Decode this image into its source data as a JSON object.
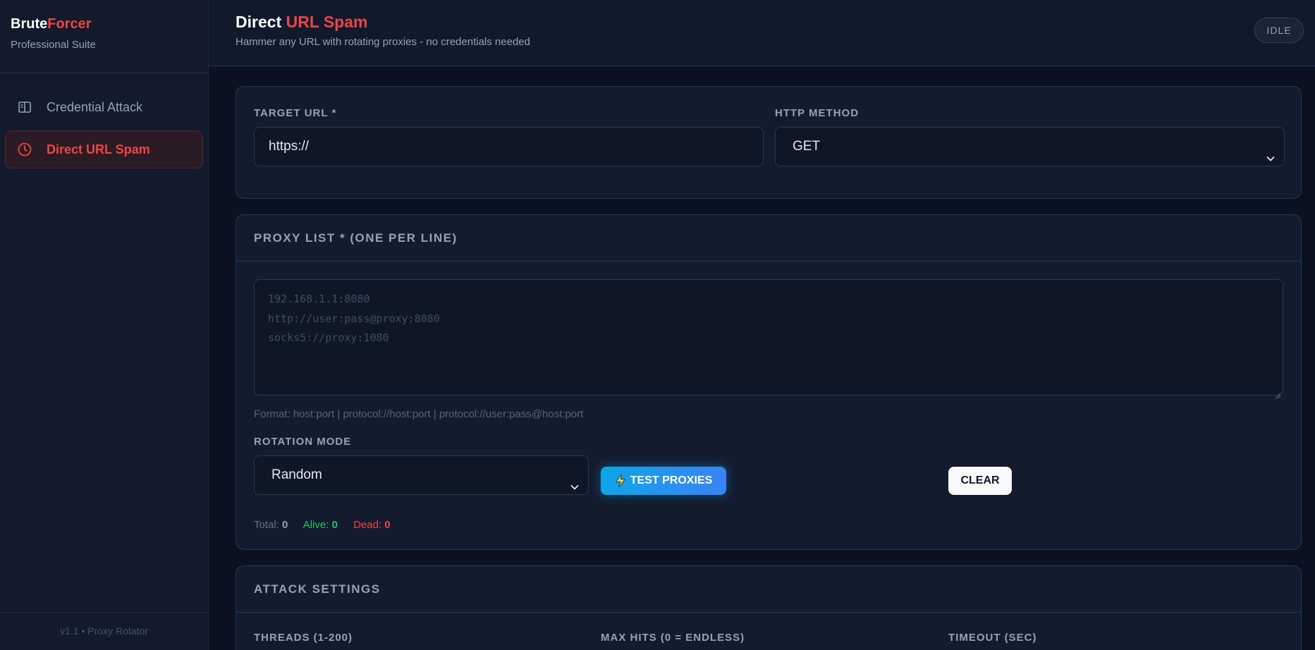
{
  "brand": {
    "name_a": "Brute",
    "name_b": "Forcer",
    "subtitle": "Professional Suite"
  },
  "nav": {
    "items": [
      {
        "label": "Credential Attack",
        "icon": "sidebar-panel-icon",
        "active": false
      },
      {
        "label": "Direct URL Spam",
        "icon": "clock-icon",
        "active": true
      }
    ]
  },
  "footer": {
    "version": "v1.1 • Proxy Rotator"
  },
  "header": {
    "title_a": "Direct",
    "title_b": "URL Spam",
    "subtitle": "Hammer any URL with rotating proxies - no credentials needed",
    "status": "IDLE"
  },
  "target": {
    "url_label": "TARGET URL *",
    "url_value": "https://",
    "method_label": "HTTP METHOD",
    "method_value": "GET"
  },
  "proxy": {
    "section_title": "PROXY LIST * (ONE PER LINE)",
    "placeholder_lines": [
      "192.168.1.1:8080",
      "http://user:pass@proxy:8080",
      "socks5://proxy:1080"
    ],
    "format_hint": "Format: host:port | protocol://host:port | protocol://user:pass@host:port",
    "rotation_label": "ROTATION MODE",
    "rotation_value": "Random",
    "test_button": "TEST PROXIES",
    "clear_button": "CLEAR",
    "stats": {
      "total_label": "Total:",
      "total": "0",
      "alive_label": "Alive:",
      "alive": "0",
      "dead_label": "Dead:",
      "dead": "0"
    }
  },
  "attack": {
    "section_title": "ATTACK SETTINGS",
    "threads_label": "THREADS (1-200)",
    "max_hits_label": "MAX HITS (0 = ENDLESS)",
    "timeout_label": "TIMEOUT (SEC)"
  },
  "colors": {
    "accent": "#ef4444",
    "background": "#0b1120",
    "card": "#131c2e",
    "success": "#22c55e",
    "info": "#0ea5e9"
  }
}
